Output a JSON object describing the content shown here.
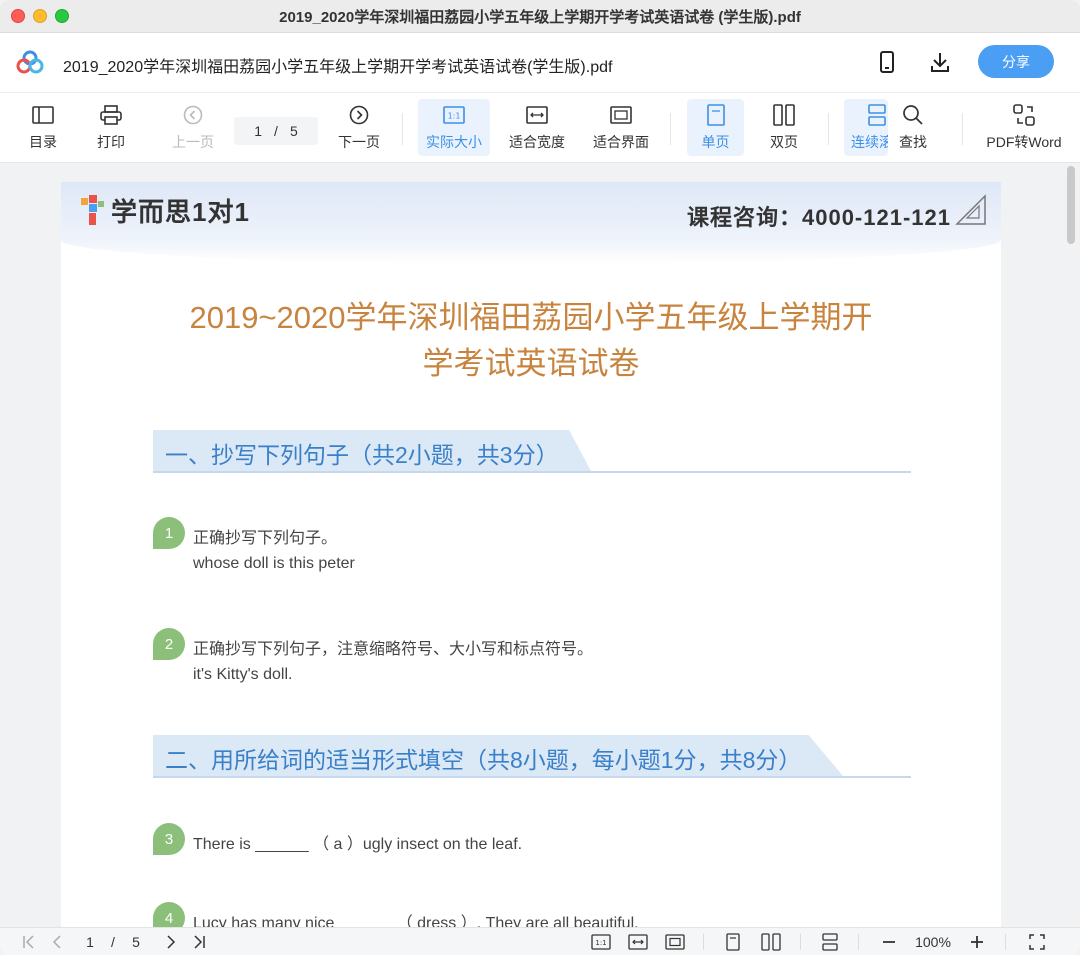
{
  "window": {
    "title": "2019_2020学年深圳福田荔园小学五年级上学期开学考试英语试卷 (学生版).pdf"
  },
  "appbar": {
    "file_name": "2019_2020学年深圳福田荔园小学五年级上学期开学考试英语试卷(学生版).pdf",
    "share_label": "分享"
  },
  "toolbar": {
    "toc": "目录",
    "print": "打印",
    "prev": "上一页",
    "page_current": "1",
    "page_sep": "/",
    "page_total": "5",
    "next": "下一页",
    "actual_size": "实际大小",
    "fit_width": "适合宽度",
    "fit_page": "适合界面",
    "single": "单页",
    "double": "双页",
    "continuous": "连续滚",
    "find": "查找",
    "pdf_to_word": "PDF转Word"
  },
  "document": {
    "brand": "学而思1对1",
    "hotline": "课程咨询：4000-121-121",
    "title_line1": "2019~2020学年深圳福田荔园小学五年级上学期开",
    "title_line2": "学考试英语试卷",
    "sections": [
      {
        "label": "一、抄写下列句子（共2小题，共3分）"
      },
      {
        "label": "二、用所给词的适当形式填空（共8小题，每小题1分，共8分）"
      }
    ],
    "questions": [
      {
        "num": "1",
        "text": "正确抄写下列句子。",
        "sub": "whose doll is this peter"
      },
      {
        "num": "2",
        "text": "正确抄写下列句子，注意缩略符号、大小写和标点符号。",
        "sub": "it's Kitty's doll."
      },
      {
        "num": "3",
        "text": "There is ______ （ a ）ugly insect on the leaf."
      },
      {
        "num": "4",
        "text": "Lucy has many nice ______ （ dress ）. They are all beautiful."
      }
    ]
  },
  "statusbar": {
    "page_current": "1",
    "page_sep": "/",
    "page_total": "5",
    "zoom": "100%"
  },
  "colors": {
    "accent": "#4a9ff5",
    "title_orange": "#c8843e",
    "section_blue": "#3a7fc9",
    "question_green": "#8cc07a"
  }
}
